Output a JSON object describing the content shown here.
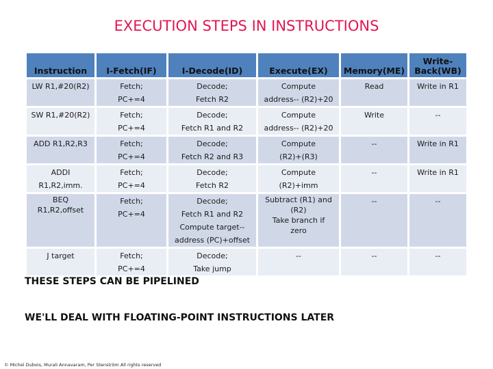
{
  "title": "EXECUTION STEPS IN INSTRUCTIONS",
  "colors": {
    "title": "#E0174F",
    "header_bg": "#4F81BD",
    "row_odd_bg": "#D0D8E8",
    "row_even_bg": "#E9EDF4"
  },
  "table": {
    "headers": [
      "Instruction",
      "I-Fetch(IF)",
      "I-Decode(ID)",
      "Execute(EX)",
      "Memory(ME)",
      "Write-\nBack(WB)"
    ],
    "header_lines": {
      "writeback_line1": "Write-",
      "writeback_line2": "Back(WB)"
    },
    "rows": [
      {
        "instruction": [
          "LW R1,#20(R2)"
        ],
        "fetch": [
          "Fetch;",
          "PC+=4"
        ],
        "decode": [
          "Decode;",
          "Fetch R2"
        ],
        "execute": [
          "Compute",
          "address-- (R2)+20"
        ],
        "memory": [
          "Read"
        ],
        "writeback": [
          "Write in R1"
        ]
      },
      {
        "instruction": [
          "SW R1,#20(R2)"
        ],
        "fetch": [
          "Fetch;",
          "PC+=4"
        ],
        "decode": [
          "Decode;",
          "Fetch R1 and R2"
        ],
        "execute": [
          "Compute",
          "address-- (R2)+20"
        ],
        "memory": [
          "Write"
        ],
        "writeback": [
          "--"
        ]
      },
      {
        "instruction": [
          "ADD R1,R2,R3"
        ],
        "fetch": [
          "Fetch;",
          "PC+=4"
        ],
        "decode": [
          "Decode;",
          "Fetch R2 and R3"
        ],
        "execute": [
          "Compute",
          "(R2)+(R3)"
        ],
        "memory": [
          "--"
        ],
        "writeback": [
          "Write in R1"
        ]
      },
      {
        "instruction": [
          "ADDI R1,R2,imm."
        ],
        "fetch": [
          "Fetch;",
          "PC+=4"
        ],
        "decode": [
          "Decode;",
          "Fetch R2"
        ],
        "execute": [
          "Compute",
          "(R2)+imm"
        ],
        "memory": [
          "--"
        ],
        "writeback": [
          "Write in R1"
        ]
      },
      {
        "instruction": [
          "BEQ",
          "R1,R2,offset"
        ],
        "fetch": [
          "Fetch;",
          "PC+=4"
        ],
        "decode": [
          "Decode;",
          "Fetch R1 and R2",
          "Compute target--",
          "address (PC)+offset"
        ],
        "execute": [
          "Subtract (R1) and",
          "(R2)",
          "Take branch if",
          "zero"
        ],
        "memory": [
          "--"
        ],
        "writeback": [
          "--"
        ]
      },
      {
        "instruction": [
          "J target"
        ],
        "fetch": [
          "Fetch;",
          "PC+=4"
        ],
        "decode": [
          "Decode;",
          "Take jump"
        ],
        "execute": [
          "--"
        ],
        "memory": [
          "--"
        ],
        "writeback": [
          "--"
        ]
      }
    ]
  },
  "notes": [
    "THESE STEPS CAN BE PIPELINED",
    "WE'LL DEAL WITH FLOATING-POINT INSTRUCTIONS LATER"
  ],
  "copyright": "© Michel Dubois, Murali Annavaram, Per Stenström All rights reserved"
}
